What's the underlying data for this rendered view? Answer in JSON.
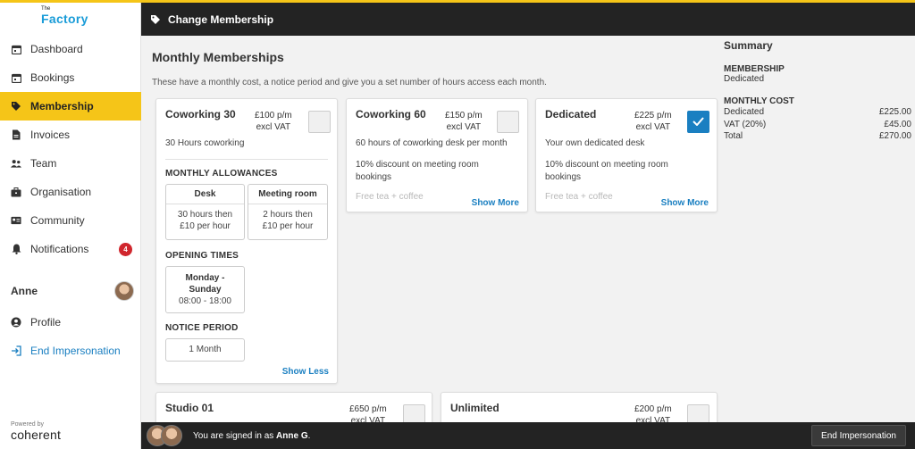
{
  "app": {
    "logo_small": "The",
    "logo_name": "Factory"
  },
  "sidebar": {
    "items": [
      {
        "label": "Dashboard",
        "icon": "calendar-icon"
      },
      {
        "label": "Bookings",
        "icon": "calendar-icon"
      },
      {
        "label": "Membership",
        "icon": "tag-icon",
        "active": true
      },
      {
        "label": "Invoices",
        "icon": "document-icon"
      },
      {
        "label": "Team",
        "icon": "people-icon"
      },
      {
        "label": "Organisation",
        "icon": "briefcase-icon"
      },
      {
        "label": "Community",
        "icon": "id-card-icon"
      },
      {
        "label": "Notifications",
        "icon": "bell-icon",
        "badge": "4"
      }
    ],
    "user_name": "Anne",
    "profile_label": "Profile",
    "end_impersonation_label": "End Impersonation",
    "powered_by": "Powered by",
    "brand": "coherent"
  },
  "header": {
    "title": "Change Membership"
  },
  "main": {
    "title": "Monthly Memberships",
    "description": "These have a monthly cost, a notice period and give you a set number of hours access each month.",
    "cards": [
      {
        "title": "Coworking 30",
        "price": "£100 p/m",
        "price_note": "excl VAT",
        "checked": false,
        "line1": "30 Hours coworking",
        "allowances_heading": "MONTHLY ALLOWANCES",
        "allowances": [
          {
            "name": "Desk",
            "value1": "30 hours then",
            "value2": "£10 per hour"
          },
          {
            "name": "Meeting room",
            "value1": "2 hours then",
            "value2": "£10 per hour"
          }
        ],
        "opening_heading": "OPENING TIMES",
        "opening_day1": "Monday -",
        "opening_day2": "Sunday",
        "opening_hours": "08:00 - 18:00",
        "notice_heading": "NOTICE PERIOD",
        "notice_value": "1 Month",
        "toggle_label": "Show Less"
      },
      {
        "title": "Coworking 60",
        "price": "£150 p/m",
        "price_note": "excl VAT",
        "checked": false,
        "line1": "60 hours of coworking desk per month",
        "line2a": "10% discount on meeting room",
        "line2b": "bookings",
        "line3": "Free tea + coffee",
        "toggle_label": "Show More"
      },
      {
        "title": "Dedicated",
        "price": "£225 p/m",
        "price_note": "excl VAT",
        "checked": true,
        "line1": "Your own dedicated desk",
        "line2a": "10% discount on meeting room",
        "line2b": "bookings",
        "line3": "Free tea + coffee",
        "toggle_label": "Show More"
      },
      {
        "title": "Studio 01",
        "price": "£650 p/m",
        "price_note": "excl VAT",
        "checked": false
      },
      {
        "title": "Unlimited",
        "price": "£200 p/m",
        "price_note": "excl VAT",
        "checked": false
      }
    ]
  },
  "summary": {
    "title": "Summary",
    "membership_label": "MEMBERSHIP",
    "membership_value": "Dedicated",
    "cost_label": "MONTHLY COST",
    "rows": [
      {
        "label": "Dedicated",
        "value": "£225.00"
      },
      {
        "label": "VAT (20%)",
        "value": "£45.00"
      },
      {
        "label": "Total",
        "value": "£270.00"
      }
    ]
  },
  "footer": {
    "signed_prefix": "You are signed in as",
    "signed_name": "Anne G",
    "signed_suffix": ".",
    "end_button": "End Impersonation"
  },
  "colors": {
    "accent": "#f5c518",
    "link": "#1a7fc1",
    "dark": "#232323",
    "badge": "#d0262d"
  }
}
